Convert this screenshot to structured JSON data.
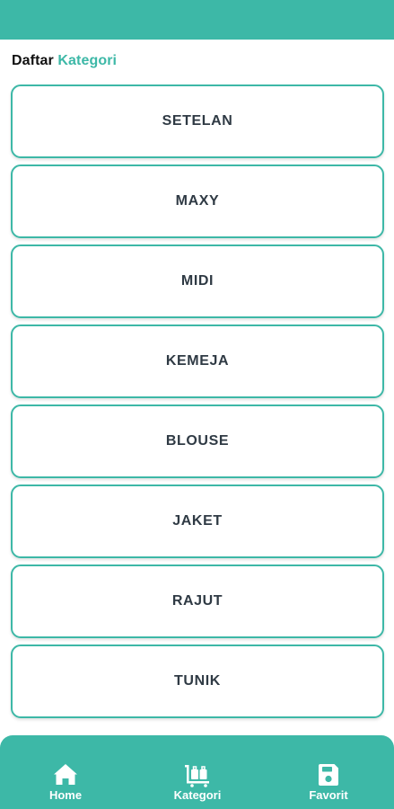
{
  "header": {
    "title_part1": "Daftar",
    "title_part2": "Kategori"
  },
  "categories": [
    "SETELAN",
    "MAXY",
    "MIDI",
    "KEMEJA",
    "BLOUSE",
    "JAKET",
    "RAJUT",
    "TUNIK"
  ],
  "bottom_nav": {
    "items": [
      {
        "label": "Home",
        "icon": "home-icon"
      },
      {
        "label": "Kategori",
        "icon": "luggage-cart-icon"
      },
      {
        "label": "Favorit",
        "icon": "save-icon"
      }
    ]
  },
  "colors": {
    "accent": "#3db8a7",
    "card_text": "#2f3a44",
    "background": "#ffffff"
  }
}
